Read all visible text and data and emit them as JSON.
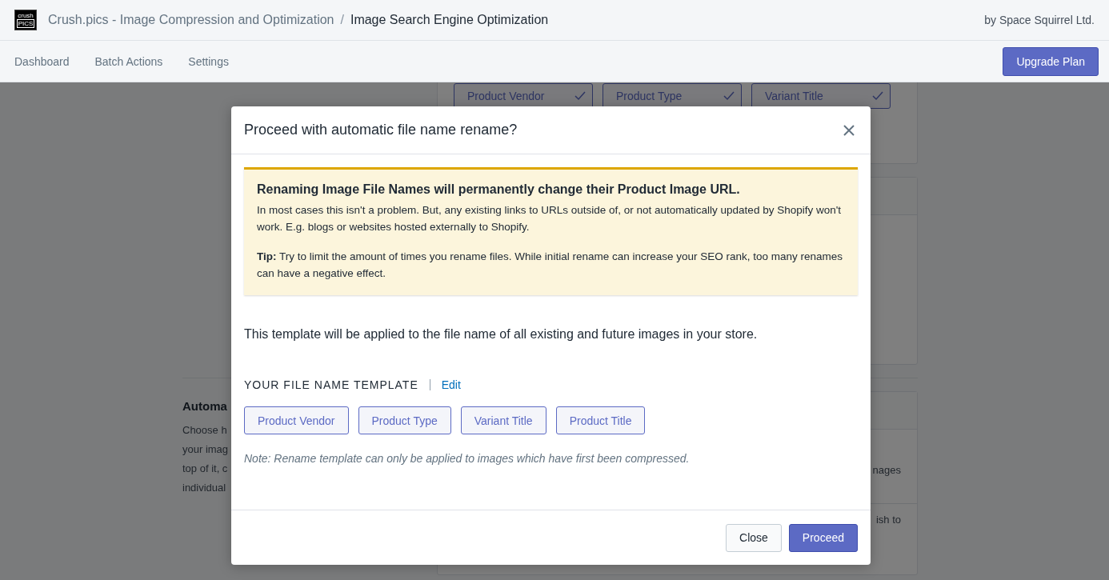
{
  "header": {
    "logo": {
      "top": "crush",
      "bottom": "PICS"
    },
    "app_name": "Crush.pics - Image Compression and Optimization",
    "separator": "/",
    "page_title": "Image Search Engine Optimization",
    "vendor": "by Space Squirrel Ltd."
  },
  "nav": {
    "items": [
      {
        "label": "Dashboard"
      },
      {
        "label": "Batch Actions"
      },
      {
        "label": "Settings"
      }
    ],
    "upgrade_button": "Upgrade Plan"
  },
  "background": {
    "template_chips": [
      {
        "label": "Product Vendor",
        "checked": true
      },
      {
        "label": "Product Type",
        "checked": true
      },
      {
        "label": "Variant Title",
        "checked": true
      }
    ],
    "section_heading": "Automa",
    "section_text": [
      "Choose h",
      "your imag",
      "top of it, c",
      "individual"
    ],
    "card_text": [
      "nages",
      "ish to"
    ]
  },
  "modal": {
    "title": "Proceed with automatic file name rename?",
    "warning": {
      "title": "Renaming Image File Names will permanently change their Product Image URL.",
      "text": "In most cases this isn't a problem. But, any existing links to URLs outside of, or not automatically updated by Shopify won't work. E.g. blogs or websites hosted externally to Shopify.",
      "tip": "**Tip:** Try to limit the amount of times you rename files. While initial rename can increase your SEO rank, too many renames can have a negative effect."
    },
    "description": "This template will be applied to the file name of all existing and future images in your store.",
    "template_label": "YOUR FILE NAME TEMPLATE",
    "edit_link": "Edit",
    "template_tags": [
      "Product Vendor",
      "Product Type",
      "Variant Title",
      "Product Title"
    ],
    "note": "Note: Rename template can only be applied to images which have first been compressed.",
    "buttons": [
      {
        "label": "Close",
        "kind": "secondary"
      },
      {
        "label": "Proceed",
        "kind": "primary"
      }
    ]
  }
}
